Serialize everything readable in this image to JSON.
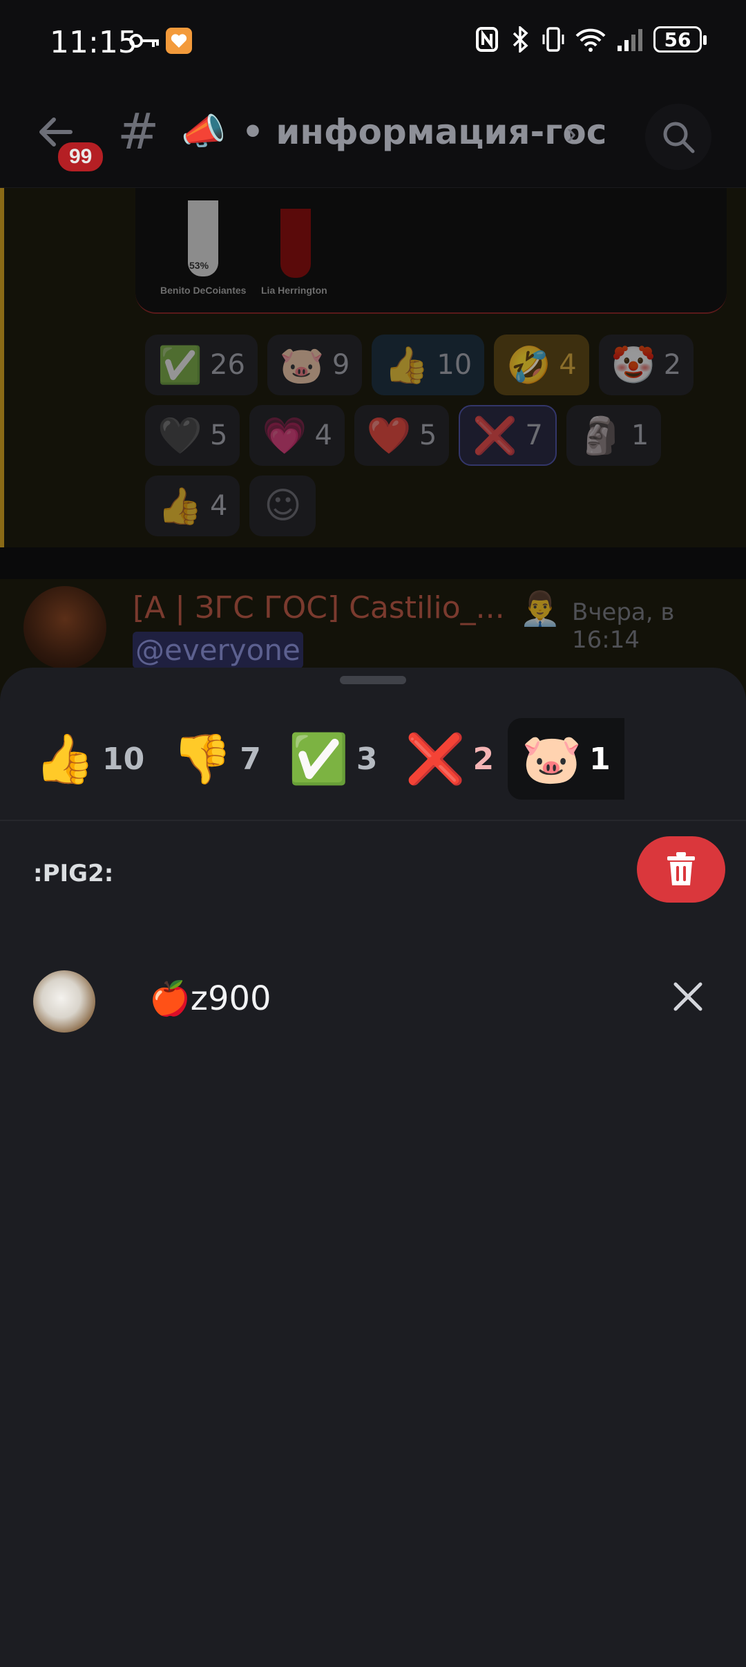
{
  "status_bar": {
    "time": "11:15",
    "battery": "56",
    "icons": [
      "key-icon",
      "app-heart-icon",
      "nfc-icon",
      "bluetooth-icon",
      "vibrate-icon",
      "wifi-icon",
      "signal-icon"
    ]
  },
  "header": {
    "unread_badge": "99",
    "channel_prefix_emoji": "📣",
    "channel_name": "• информация-гос",
    "chevron": "›"
  },
  "poll_embed": {
    "candidate_1": "Benito DeCoiantes",
    "candidate_1_percent": "53%",
    "candidate_2": "Lia Herrington"
  },
  "message_reactions": {
    "rows": [
      [
        {
          "emoji": "✅",
          "count": "26",
          "name": "reaction-check"
        },
        {
          "emoji": "🐷",
          "count": "9",
          "name": "reaction-pig"
        },
        {
          "emoji": "👍",
          "count": "10",
          "name": "reaction-thumbs-up"
        },
        {
          "emoji": "🤣",
          "count": "4",
          "name": "reaction-rofl"
        },
        {
          "emoji": "🤡",
          "count": "2",
          "name": "reaction-clown"
        }
      ],
      [
        {
          "emoji": "🖤",
          "count": "5",
          "name": "reaction-black-heart"
        },
        {
          "emoji": "💗",
          "count": "4",
          "name": "reaction-anime-heart"
        },
        {
          "emoji": "❤️",
          "count": "5",
          "name": "reaction-red-heart"
        },
        {
          "emoji": "❌",
          "count": "7",
          "name": "reaction-cross"
        },
        {
          "emoji": "🗿",
          "count": "1",
          "name": "reaction-moai"
        }
      ],
      [
        {
          "emoji": "👍",
          "count": "4",
          "name": "reaction-thumb-smiley"
        },
        {
          "emoji": "☺",
          "count": "",
          "name": "add-reaction"
        }
      ]
    ]
  },
  "message_2": {
    "author": "[A | ЗГС ГОС] Castilio_...",
    "role_icon": "👨‍💼",
    "timestamp": "Вчера, в 16:14",
    "mention": "@everyone"
  },
  "sheet": {
    "tabs": [
      {
        "emoji": "👍",
        "count": "10"
      },
      {
        "emoji": "👎",
        "count": "7"
      },
      {
        "emoji": "✅",
        "count": "3"
      },
      {
        "emoji": "❌",
        "count": "2"
      },
      {
        "emoji": "🐷",
        "count": "1"
      }
    ],
    "selected_emoji_name": ":PIG2:",
    "users": [
      {
        "name": "🍎z900"
      }
    ]
  },
  "colors": {
    "sheet_bg": "#1c1d22",
    "delete_red": "#da373c",
    "active_tab_bg": "#111214"
  }
}
